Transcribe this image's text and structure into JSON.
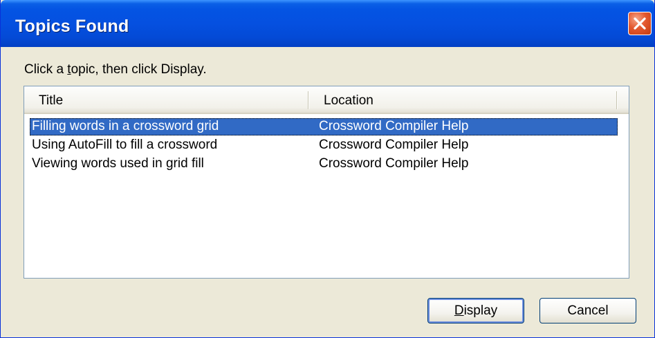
{
  "window": {
    "title": "Topics Found"
  },
  "prompt": "Click a topic, then click Display.",
  "prompt_accel_index": 8,
  "list": {
    "columns": [
      "Title",
      "Location"
    ],
    "rows": [
      {
        "title": "Filling words in a crossword grid",
        "location": "Crossword Compiler Help",
        "selected": true
      },
      {
        "title": "Using AutoFill to fill a crossword",
        "location": "Crossword Compiler Help",
        "selected": false
      },
      {
        "title": "Viewing words used in grid fill",
        "location": "Crossword Compiler Help",
        "selected": false
      }
    ]
  },
  "buttons": {
    "display": "Display",
    "cancel": "Cancel"
  },
  "colors": {
    "titlebar": "#0454e3",
    "selection": "#316ac5",
    "dialog_bg": "#ece9d8",
    "close": "#e3582f"
  }
}
